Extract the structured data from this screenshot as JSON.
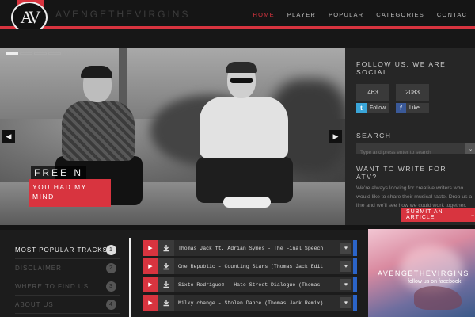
{
  "header": {
    "logo_letters": "AV",
    "brand": "AVENGETHEVIRGINS",
    "nav": [
      {
        "label": "HOME",
        "active": true
      },
      {
        "label": "PLAYER",
        "active": false
      },
      {
        "label": "POPULAR",
        "active": false
      },
      {
        "label": "CATEGORIES",
        "active": false
      },
      {
        "label": "CONTACT",
        "active": false
      }
    ]
  },
  "hero": {
    "caption_line1": "FREE N",
    "caption_line2": "YOU HAD MY MIND",
    "slides": 4,
    "active_slide": 1,
    "prev_icon": "chevron-left-icon",
    "next_icon": "chevron-right-icon"
  },
  "sidebar": {
    "follow_heading": "FOLLOW US, WE ARE SOCIAL",
    "twitter_count": "463",
    "facebook_count": "2083",
    "twitter_label": "Follow",
    "facebook_label": "Like",
    "search_heading": "SEARCH",
    "search_placeholder": "Type and press enter to search",
    "write_heading": "WANT TO WRITE FOR ATV?",
    "write_text": "We're always looking for creative writers who would like to share their musical taste. Drop us a line and we'll see how we could work together.",
    "submit_label": "SUBMIT AN ARTICLE"
  },
  "bottom_nav": [
    {
      "label": "MOST POPULAR TRACKS",
      "num": "1",
      "active": true
    },
    {
      "label": "DISCLAIMER",
      "num": "2",
      "active": false
    },
    {
      "label": "WHERE TO FIND US",
      "num": "3",
      "active": false
    },
    {
      "label": "ABOUT US",
      "num": "4",
      "active": false
    }
  ],
  "tracks": [
    "Thomas Jack ft. Adrian Symes - The Final Speech",
    "One Republic - Counting Stars (Thomas Jack Edit)",
    "Sixto Rodriguez - Hate Street Dialogue (Thomas ..",
    "Milky change - Stolen Dance (Thomas Jack Remix)"
  ],
  "fb_promo": {
    "line1": "AVENGETHEVIRGINS",
    "line2": "follow us on facebook"
  },
  "colors": {
    "accent": "#d8343f",
    "twitter": "#3aa5d8",
    "facebook": "#3a5998"
  }
}
